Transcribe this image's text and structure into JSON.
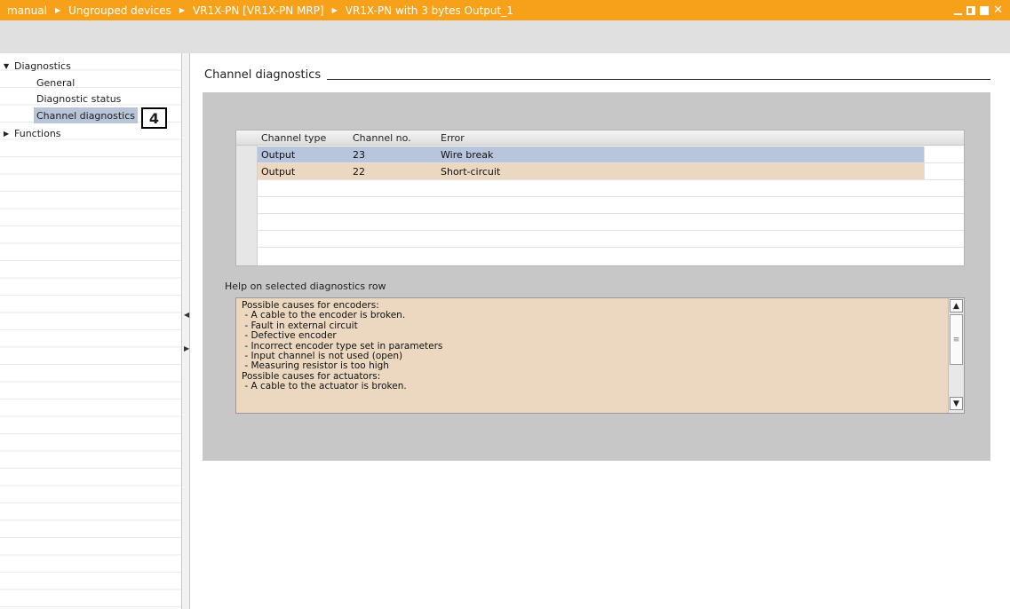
{
  "title_bar": {
    "breadcrumbs": [
      "manual",
      "Ungrouped devices",
      "VR1X-PN [VR1X-PN MRP]",
      "VR1X-PN with 3 bytes Output_1"
    ],
    "separator_icon": "triangle-right-icon",
    "controls": [
      "minimize-icon",
      "tile-icon",
      "maximize-icon",
      "close-icon"
    ],
    "close_glyph": "✕",
    "accent_color": "#f7a11b"
  },
  "nav": {
    "diagnostics": "Diagnostics",
    "items": [
      {
        "label": "General"
      },
      {
        "label": "Diagnostic status"
      },
      {
        "label": "Channel diagnostics",
        "selected": true
      }
    ],
    "functions": "Functions",
    "callout": "4"
  },
  "main": {
    "section_title": "Channel diagnostics",
    "table": {
      "columns": [
        "Channel type",
        "Channel no.",
        "Error"
      ],
      "rows": [
        {
          "channel_type": "Output",
          "channel_no": "23",
          "error": "Wire break",
          "state": "selected"
        },
        {
          "channel_type": "Output",
          "channel_no": "22",
          "error": "Short-circuit",
          "state": "error"
        }
      ]
    },
    "help": {
      "label": "Help on selected diagnostics row",
      "text": "Possible causes for encoders:\n - A cable to the encoder is broken.\n - Fault in external circuit\n - Defective encoder\n - Incorrect encoder type set in parameters\n - Input channel is not used (open)\n - Measuring resistor is too high\nPossible causes for actuators:\n - A cable to the actuator is broken."
    }
  },
  "colors": {
    "selected_row": "#b9c4dd",
    "error_row": "#ecd8c0",
    "panel": "#c7c7c7"
  }
}
